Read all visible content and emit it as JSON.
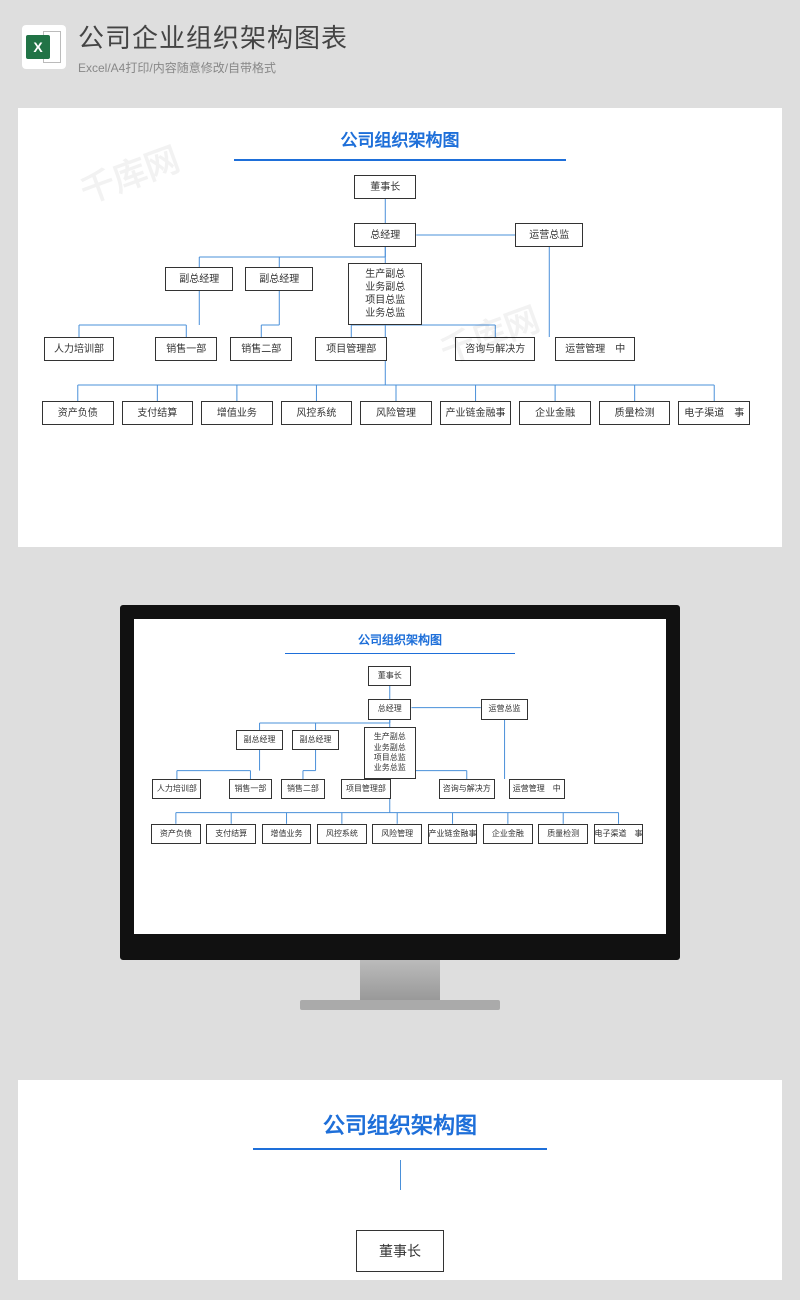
{
  "header": {
    "icon_letter": "X",
    "title": "公司企业组织架构图表",
    "subtitle": "Excel/A4打印/内容随意修改/自带格式"
  },
  "chart": {
    "title": "公司组织架构图",
    "watermark": "千库网",
    "nodes": {
      "chairman": "董事长",
      "gm": "总经理",
      "ops_director": "运营总监",
      "vp1": "副总经理",
      "vp2": "副总经理",
      "multi": [
        "生产副总",
        "业务副总",
        "项目总监",
        "业务总监"
      ],
      "hr": "人力培训部",
      "sales1": "销售一部",
      "sales2": "销售二部",
      "pm": "项目管理部",
      "consult": "咨询与解决方",
      "ops_center": "运营管理　中",
      "bottom": [
        "资产负债",
        "支付结算",
        "增值业务",
        "风控系统",
        "风险管理",
        "产业链金融事",
        "企业金融",
        "质量检测",
        "电子渠道　事"
      ]
    }
  }
}
